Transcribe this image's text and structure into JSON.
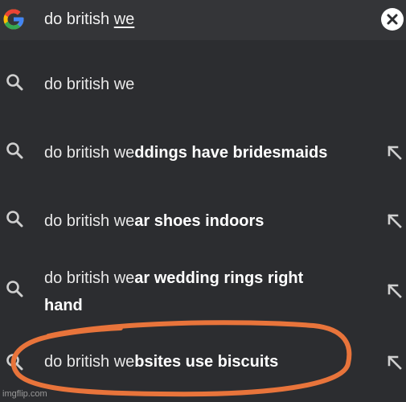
{
  "search": {
    "query_prefix": "do british ",
    "query_cursor_word": "we",
    "clear_icon": "close-circle-icon",
    "logo_icon": "google-g-logo"
  },
  "suggestions": [
    {
      "typed": "do british we",
      "completion": "",
      "completion_cont": ""
    },
    {
      "typed": "do british we",
      "completion": "ddings have bridesmaids",
      "completion_cont": ""
    },
    {
      "typed": "do british we",
      "completion": "ar shoes indoors",
      "completion_cont": ""
    },
    {
      "typed": "do british we",
      "completion": "ar wedding rings right",
      "completion_cont": "hand"
    },
    {
      "typed": "do british we",
      "completion": "bsites use biscuits",
      "completion_cont": ""
    }
  ],
  "icons": {
    "suggestion_icon": "search-icon",
    "fill_icon": "arrow-up-left-icon"
  },
  "annotation": {
    "color": "#e8743b"
  },
  "watermark": "imgflip.com"
}
